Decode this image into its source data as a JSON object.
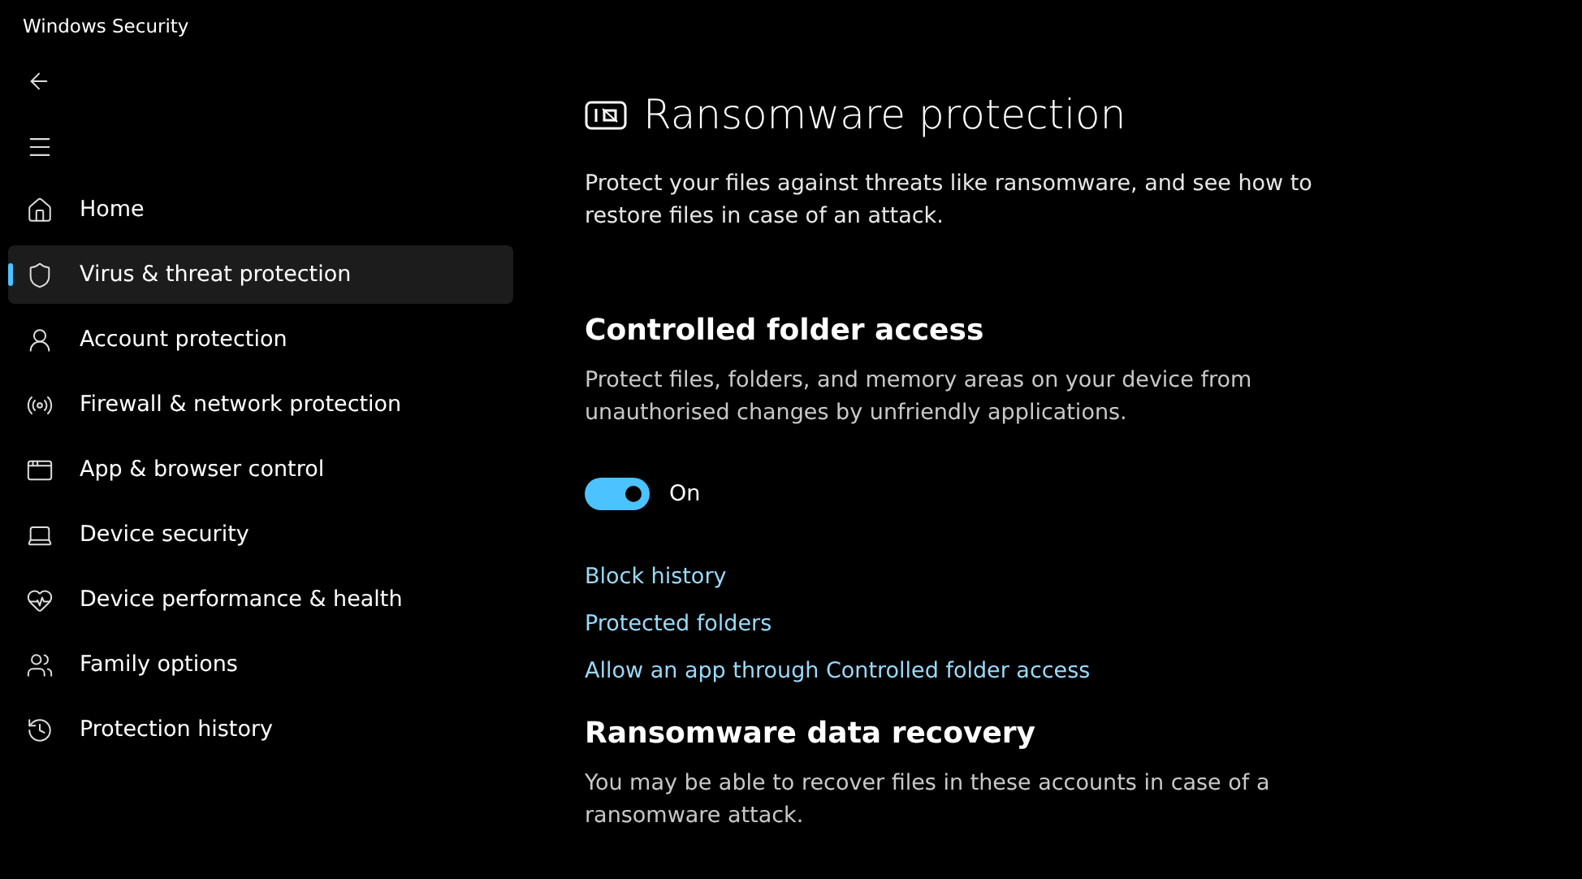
{
  "window": {
    "title": "Windows Security"
  },
  "sidebar": {
    "items": [
      {
        "label": "Home",
        "selected": false
      },
      {
        "label": "Virus & threat protection",
        "selected": true
      },
      {
        "label": "Account protection",
        "selected": false
      },
      {
        "label": "Firewall & network protection",
        "selected": false
      },
      {
        "label": "App & browser control",
        "selected": false
      },
      {
        "label": "Device security",
        "selected": false
      },
      {
        "label": "Device performance & health",
        "selected": false
      },
      {
        "label": "Family options",
        "selected": false
      },
      {
        "label": "Protection history",
        "selected": false
      }
    ]
  },
  "page": {
    "title": "Ransomware protection",
    "description": "Protect your files against threats like ransomware, and see how to restore files in case of an attack."
  },
  "controlled_folder_access": {
    "heading": "Controlled folder access",
    "description": "Protect files, folders, and memory areas on your device from unauthorised changes by unfriendly applications.",
    "toggle": {
      "on": true,
      "label": "On"
    },
    "links": [
      "Block history",
      "Protected folders",
      "Allow an app through Controlled folder access"
    ]
  },
  "data_recovery": {
    "heading": "Ransomware data recovery",
    "description": "You may be able to recover files in these accounts in case of a ransomware attack."
  }
}
